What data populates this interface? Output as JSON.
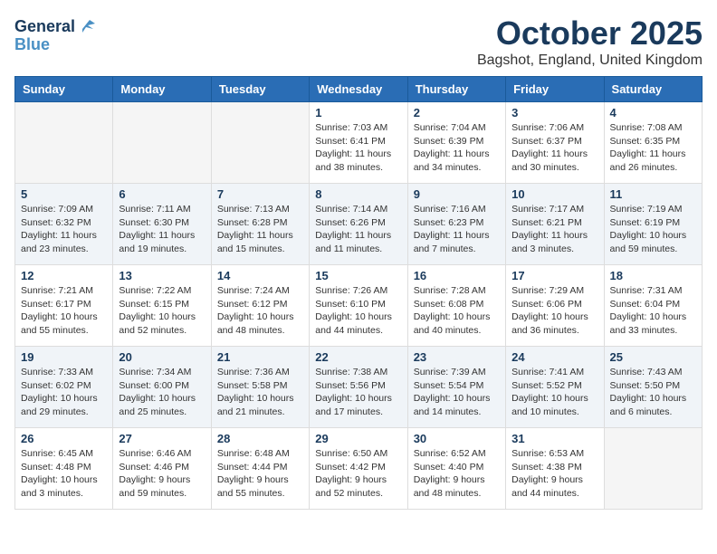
{
  "logo": {
    "line1": "General",
    "line2": "Blue"
  },
  "title": "October 2025",
  "location": "Bagshot, England, United Kingdom",
  "weekdays": [
    "Sunday",
    "Monday",
    "Tuesday",
    "Wednesday",
    "Thursday",
    "Friday",
    "Saturday"
  ],
  "weeks": [
    [
      {
        "day": "",
        "info": ""
      },
      {
        "day": "",
        "info": ""
      },
      {
        "day": "",
        "info": ""
      },
      {
        "day": "1",
        "info": "Sunrise: 7:03 AM\nSunset: 6:41 PM\nDaylight: 11 hours\nand 38 minutes."
      },
      {
        "day": "2",
        "info": "Sunrise: 7:04 AM\nSunset: 6:39 PM\nDaylight: 11 hours\nand 34 minutes."
      },
      {
        "day": "3",
        "info": "Sunrise: 7:06 AM\nSunset: 6:37 PM\nDaylight: 11 hours\nand 30 minutes."
      },
      {
        "day": "4",
        "info": "Sunrise: 7:08 AM\nSunset: 6:35 PM\nDaylight: 11 hours\nand 26 minutes."
      }
    ],
    [
      {
        "day": "5",
        "info": "Sunrise: 7:09 AM\nSunset: 6:32 PM\nDaylight: 11 hours\nand 23 minutes."
      },
      {
        "day": "6",
        "info": "Sunrise: 7:11 AM\nSunset: 6:30 PM\nDaylight: 11 hours\nand 19 minutes."
      },
      {
        "day": "7",
        "info": "Sunrise: 7:13 AM\nSunset: 6:28 PM\nDaylight: 11 hours\nand 15 minutes."
      },
      {
        "day": "8",
        "info": "Sunrise: 7:14 AM\nSunset: 6:26 PM\nDaylight: 11 hours\nand 11 minutes."
      },
      {
        "day": "9",
        "info": "Sunrise: 7:16 AM\nSunset: 6:23 PM\nDaylight: 11 hours\nand 7 minutes."
      },
      {
        "day": "10",
        "info": "Sunrise: 7:17 AM\nSunset: 6:21 PM\nDaylight: 11 hours\nand 3 minutes."
      },
      {
        "day": "11",
        "info": "Sunrise: 7:19 AM\nSunset: 6:19 PM\nDaylight: 10 hours\nand 59 minutes."
      }
    ],
    [
      {
        "day": "12",
        "info": "Sunrise: 7:21 AM\nSunset: 6:17 PM\nDaylight: 10 hours\nand 55 minutes."
      },
      {
        "day": "13",
        "info": "Sunrise: 7:22 AM\nSunset: 6:15 PM\nDaylight: 10 hours\nand 52 minutes."
      },
      {
        "day": "14",
        "info": "Sunrise: 7:24 AM\nSunset: 6:12 PM\nDaylight: 10 hours\nand 48 minutes."
      },
      {
        "day": "15",
        "info": "Sunrise: 7:26 AM\nSunset: 6:10 PM\nDaylight: 10 hours\nand 44 minutes."
      },
      {
        "day": "16",
        "info": "Sunrise: 7:28 AM\nSunset: 6:08 PM\nDaylight: 10 hours\nand 40 minutes."
      },
      {
        "day": "17",
        "info": "Sunrise: 7:29 AM\nSunset: 6:06 PM\nDaylight: 10 hours\nand 36 minutes."
      },
      {
        "day": "18",
        "info": "Sunrise: 7:31 AM\nSunset: 6:04 PM\nDaylight: 10 hours\nand 33 minutes."
      }
    ],
    [
      {
        "day": "19",
        "info": "Sunrise: 7:33 AM\nSunset: 6:02 PM\nDaylight: 10 hours\nand 29 minutes."
      },
      {
        "day": "20",
        "info": "Sunrise: 7:34 AM\nSunset: 6:00 PM\nDaylight: 10 hours\nand 25 minutes."
      },
      {
        "day": "21",
        "info": "Sunrise: 7:36 AM\nSunset: 5:58 PM\nDaylight: 10 hours\nand 21 minutes."
      },
      {
        "day": "22",
        "info": "Sunrise: 7:38 AM\nSunset: 5:56 PM\nDaylight: 10 hours\nand 17 minutes."
      },
      {
        "day": "23",
        "info": "Sunrise: 7:39 AM\nSunset: 5:54 PM\nDaylight: 10 hours\nand 14 minutes."
      },
      {
        "day": "24",
        "info": "Sunrise: 7:41 AM\nSunset: 5:52 PM\nDaylight: 10 hours\nand 10 minutes."
      },
      {
        "day": "25",
        "info": "Sunrise: 7:43 AM\nSunset: 5:50 PM\nDaylight: 10 hours\nand 6 minutes."
      }
    ],
    [
      {
        "day": "26",
        "info": "Sunrise: 6:45 AM\nSunset: 4:48 PM\nDaylight: 10 hours\nand 3 minutes."
      },
      {
        "day": "27",
        "info": "Sunrise: 6:46 AM\nSunset: 4:46 PM\nDaylight: 9 hours\nand 59 minutes."
      },
      {
        "day": "28",
        "info": "Sunrise: 6:48 AM\nSunset: 4:44 PM\nDaylight: 9 hours\nand 55 minutes."
      },
      {
        "day": "29",
        "info": "Sunrise: 6:50 AM\nSunset: 4:42 PM\nDaylight: 9 hours\nand 52 minutes."
      },
      {
        "day": "30",
        "info": "Sunrise: 6:52 AM\nSunset: 4:40 PM\nDaylight: 9 hours\nand 48 minutes."
      },
      {
        "day": "31",
        "info": "Sunrise: 6:53 AM\nSunset: 4:38 PM\nDaylight: 9 hours\nand 44 minutes."
      },
      {
        "day": "",
        "info": ""
      }
    ]
  ]
}
